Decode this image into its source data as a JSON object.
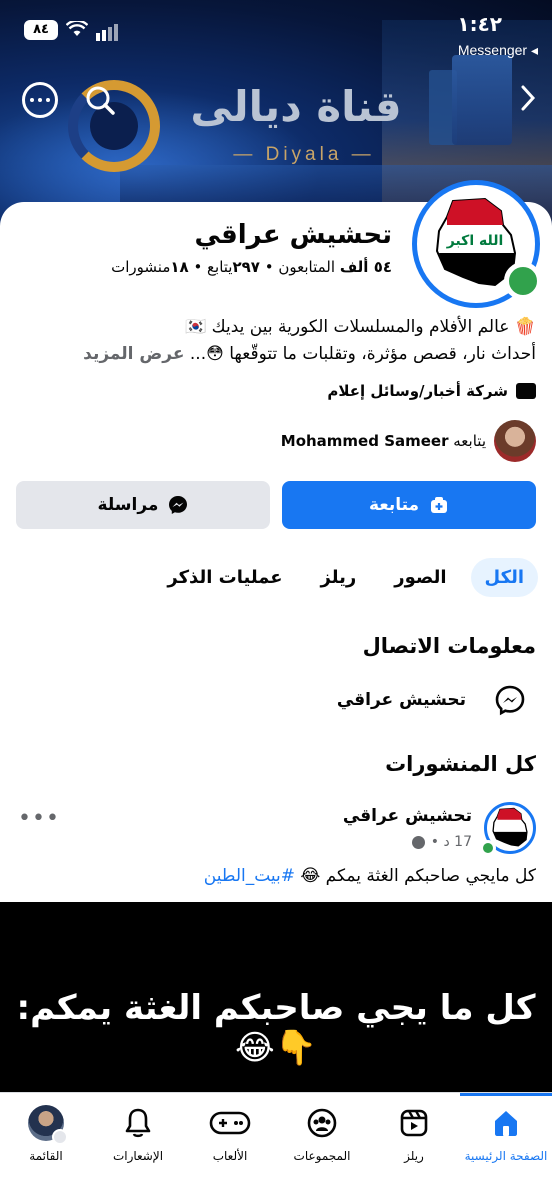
{
  "status_bar": {
    "time": "١:٤٢",
    "battery": "٨٤",
    "back_app": "Messenger ◂"
  },
  "cover": {
    "brand_title": "قناة ديالى",
    "brand_subtitle": "— Diyala —"
  },
  "profile": {
    "name": "تحشيش عراقي",
    "stats_followers": "٥٤ ألف",
    "stats_followers_label": " المتابعون • ",
    "stats_following": "٢٩٧",
    "stats_following_label": "يتابع • ",
    "stats_posts": "١٨",
    "stats_posts_label": "منشورات",
    "bio_line1": "🍿 عالم الأفلام والمسلسلات الكورية بين يديك 🇰🇷",
    "bio_line2": "أحداث نار، قصص مؤثرة، وتقلبات ما تتوقّعها 😳... ",
    "see_more": "عرض المزيد",
    "category": "شركة أخبار/وسائل إعلام",
    "followed_by_prefix": "يتابعه ",
    "followed_by_name": "Mohammed Sameer"
  },
  "actions": {
    "follow_label": "متابعة",
    "message_label": "مراسلة"
  },
  "tabs": [
    {
      "label": "الكل",
      "active": true
    },
    {
      "label": "الصور"
    },
    {
      "label": "ريلز"
    },
    {
      "label": "عمليات الذكر"
    }
  ],
  "contact": {
    "title": "معلومات الاتصال",
    "messenger_name": "تحشيش عراقي"
  },
  "posts_section": {
    "title": "كل المنشورات"
  },
  "post": {
    "author": "تحشيش عراقي",
    "time": "17 د •",
    "more": "•••",
    "text": "كل مايجي صاحبكم الغثة يمكم 😂 ",
    "hashtag": "#بيت_الطين",
    "image_text": "كل ما يجي صاحبكم الغثة يمكم:👇😂"
  },
  "bottom_nav": [
    {
      "label": "الصفحة الرئيسية",
      "icon": "home-icon",
      "active": true
    },
    {
      "label": "ريلز",
      "icon": "reels-icon"
    },
    {
      "label": "المجموعات",
      "icon": "groups-icon"
    },
    {
      "label": "الألعاب",
      "icon": "gaming-icon"
    },
    {
      "label": "الإشعارات",
      "icon": "bell-icon"
    },
    {
      "label": "القائمة",
      "icon": "menu-avatar-icon"
    }
  ],
  "colors": {
    "accent": "#1877f2",
    "online": "#31a24c"
  }
}
